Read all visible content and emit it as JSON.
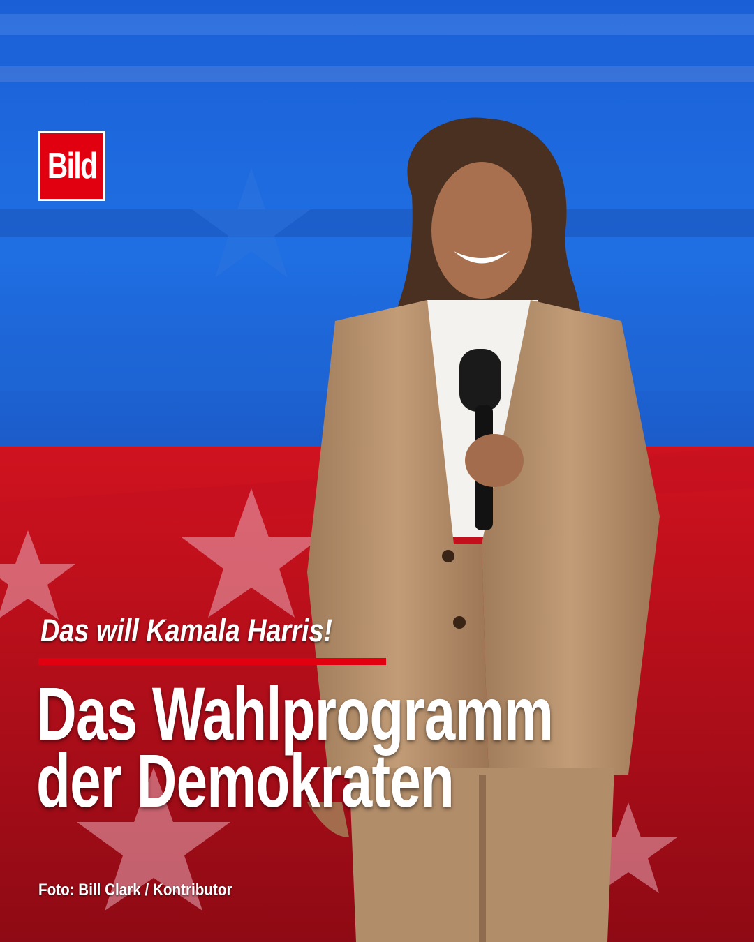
{
  "logo": {
    "text": "Bild"
  },
  "kicker": "Das will Kamala Harris!",
  "headline": {
    "line1": "Das Wahlprogramm",
    "line2": "der Demokraten"
  },
  "credit": "Foto: Bill Clark / Kontributor",
  "colors": {
    "brand_red": "#e1000f",
    "backdrop_blue": "#1a58c8",
    "backdrop_red": "#b8101c",
    "suit": "#b48f6c"
  }
}
